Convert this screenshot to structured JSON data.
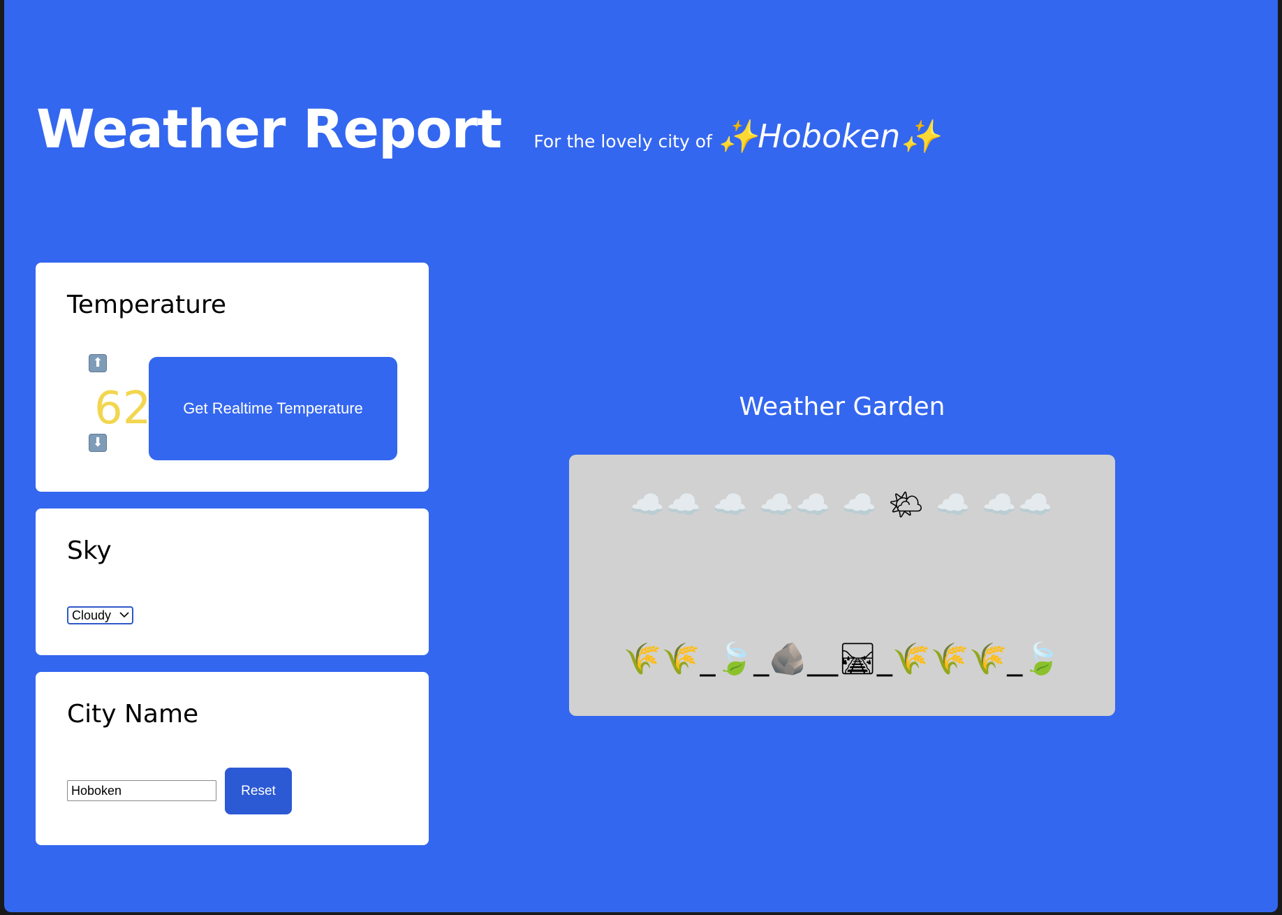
{
  "header": {
    "title": "Weather Report",
    "subtitle_prefix": "For the lovely city of",
    "city_display": "✨Hoboken✨"
  },
  "temperature": {
    "heading": "Temperature",
    "value": "62",
    "value_color": "#f2d64f",
    "increase_icon": "⬆",
    "decrease_icon": "⬇",
    "realtime_button_label": "Get Realtime Temperature"
  },
  "sky": {
    "heading": "Sky",
    "selected_option": "Cloudy"
  },
  "city": {
    "heading": "City Name",
    "input_value": "Hoboken",
    "reset_label": "Reset"
  },
  "garden": {
    "title": "Weather Garden",
    "sky_emoji": "☁️☁️ ☁️ ☁️☁️ ☁️ 🌤 ☁️ ☁️☁️",
    "landscape_emoji": "🌾🌾_🍃_🪨__🛤_🌾🌾🌾_🍃"
  },
  "colors": {
    "background": "#3467ef",
    "panel": "#ffffff",
    "garden_bg": "#d1d1d1",
    "button": "#3467ef"
  }
}
